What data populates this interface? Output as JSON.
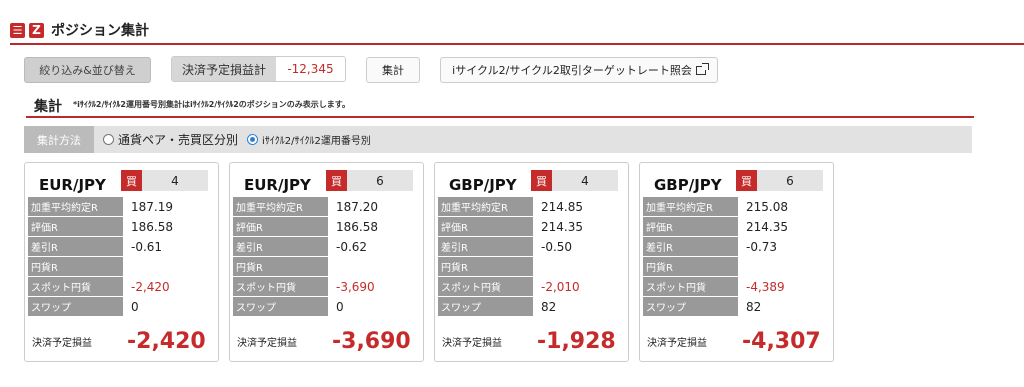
{
  "header": {
    "title": "ポジション集計"
  },
  "toolbar": {
    "filter_button": "絞り込み&並び替え",
    "pl_label": "決済予定損益計",
    "pl_value": "-12,345",
    "aggregate_button": "集計",
    "target_rate_link": "iサイクル2/サイクル2取引ターゲットレート照会"
  },
  "section": {
    "title": "集計",
    "note": "*iｻｲｸﾙ2/ｻｲｸﾙ2運用番号別集計はiｻｲｸﾙ2/ｻｲｸﾙ2のポジションのみ表示します。"
  },
  "method": {
    "label": "集計方法",
    "option1": "通貨ペア・売買区分別",
    "option2": "iｻｲｸﾙ2/ｻｲｸﾙ2運用番号別",
    "selected": "option2"
  },
  "row_labels": {
    "avg_rate": "加重平均約定R",
    "eval_rate": "評価R",
    "diff": "差引R",
    "jpy_rate": "円貨R",
    "spot_jpy": "スポット円貨",
    "swap": "スワップ",
    "settle_pl": "決済予定損益"
  },
  "cards": [
    {
      "pair": "EUR/JPY",
      "side": "買",
      "qty": "4",
      "avg_rate": "187.19",
      "eval_rate": "186.58",
      "diff": "-0.61",
      "jpy_rate": "",
      "spot_jpy": "-2,420",
      "swap": "0",
      "settle_pl": "-2,420"
    },
    {
      "pair": "EUR/JPY",
      "side": "買",
      "qty": "6",
      "avg_rate": "187.20",
      "eval_rate": "186.58",
      "diff": "-0.62",
      "jpy_rate": "",
      "spot_jpy": "-3,690",
      "swap": "0",
      "settle_pl": "-3,690"
    },
    {
      "pair": "GBP/JPY",
      "side": "買",
      "qty": "4",
      "avg_rate": "214.85",
      "eval_rate": "214.35",
      "diff": "-0.50",
      "jpy_rate": "",
      "spot_jpy": "-2,010",
      "swap": "82",
      "settle_pl": "-1,928"
    },
    {
      "pair": "GBP/JPY",
      "side": "買",
      "qty": "6",
      "avg_rate": "215.08",
      "eval_rate": "214.35",
      "diff": "-0.73",
      "jpy_rate": "",
      "spot_jpy": "-4,389",
      "swap": "82",
      "settle_pl": "-4,307"
    }
  ],
  "colors": {
    "accent": "#c62b2b",
    "label_bg": "#999999",
    "method_label_bg": "#bbbbbb"
  }
}
